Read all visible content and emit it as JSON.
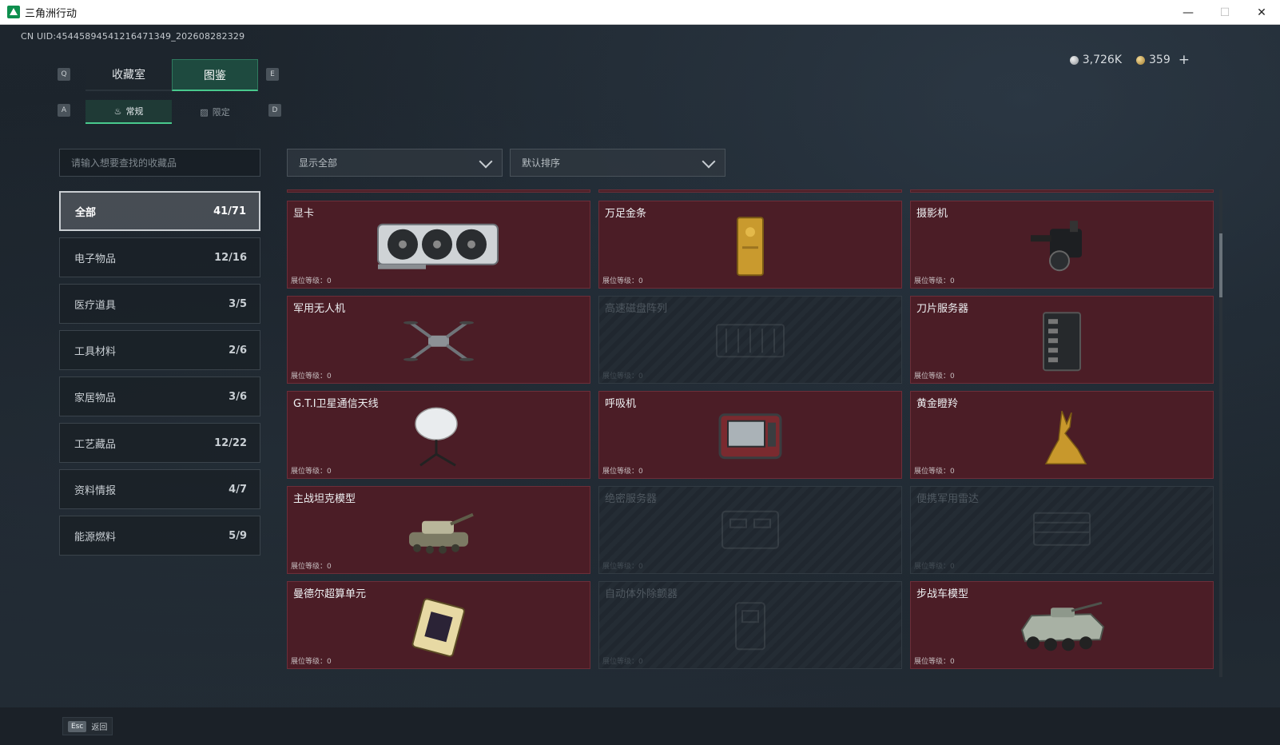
{
  "window": {
    "title": "三角洲行动",
    "minimize": "—",
    "maximize": "☐",
    "close": "✕"
  },
  "uid": "CN UID:4544589454121647134​9_202608282329",
  "currency": {
    "silver": "3,726K",
    "gold": "359",
    "plus": "+"
  },
  "keys": {
    "q": "Q",
    "e": "E",
    "a": "A",
    "d": "D"
  },
  "main_tabs": [
    {
      "label": "收藏室"
    },
    {
      "label": "图鉴"
    }
  ],
  "sub_tabs": [
    {
      "label": "常规",
      "icon": "flame-icon"
    },
    {
      "label": "限定",
      "icon": "picture-icon"
    }
  ],
  "search": {
    "placeholder": "请输入想要查找的收藏品"
  },
  "filters": {
    "show": "显示全部",
    "sort": "默认排序"
  },
  "categories": [
    {
      "label": "全部",
      "count": "41/71"
    },
    {
      "label": "电子物品",
      "count": "12/16"
    },
    {
      "label": "医疗道具",
      "count": "3/5"
    },
    {
      "label": "工具材料",
      "count": "2/6"
    },
    {
      "label": "家居物品",
      "count": "3/6"
    },
    {
      "label": "工艺藏品",
      "count": "12/22"
    },
    {
      "label": "资料情报",
      "count": "4/7"
    },
    {
      "label": "能源燃料",
      "count": "5/9"
    }
  ],
  "level_label": "展位等级：0",
  "items": [
    {
      "name": "显卡",
      "locked": false,
      "icon": "gpu-icon"
    },
    {
      "name": "万足金条",
      "locked": false,
      "icon": "gold-bar-icon"
    },
    {
      "name": "摄影机",
      "locked": false,
      "icon": "camera-icon"
    },
    {
      "name": "军用无人机",
      "locked": false,
      "icon": "drone-icon"
    },
    {
      "name": "高速磁盘阵列",
      "locked": true,
      "icon": "disk-array-icon"
    },
    {
      "name": "刀片服务器",
      "locked": false,
      "icon": "server-icon"
    },
    {
      "name": "G.T.I卫星通信天线",
      "locked": false,
      "icon": "satellite-dish-icon"
    },
    {
      "name": "呼吸机",
      "locked": false,
      "icon": "ventilator-icon"
    },
    {
      "name": "黄金瞪羚",
      "locked": false,
      "icon": "gold-gazelle-icon"
    },
    {
      "name": "主战坦克模型",
      "locked": false,
      "icon": "tank-icon"
    },
    {
      "name": "绝密服务器",
      "locked": true,
      "icon": "secret-server-icon"
    },
    {
      "name": "便携军用雷达",
      "locked": true,
      "icon": "radar-icon"
    },
    {
      "name": "曼德尔超算单元",
      "locked": false,
      "icon": "chip-icon"
    },
    {
      "name": "自动体外除颤器",
      "locked": true,
      "icon": "defibrillator-icon"
    },
    {
      "name": "步战车模型",
      "locked": false,
      "icon": "ifv-icon"
    }
  ],
  "bottom": {
    "esc_key": "Esc",
    "esc_label": "返回"
  }
}
